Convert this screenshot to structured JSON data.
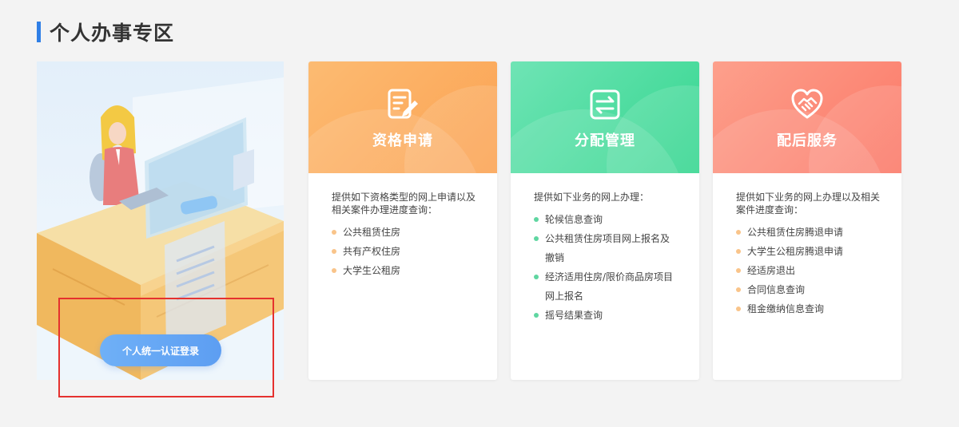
{
  "section": {
    "title": "个人办事专区"
  },
  "login": {
    "label": "个人统一认证登录"
  },
  "cards": [
    {
      "title": "资格申请",
      "icon": "edit-document-icon",
      "description": "提供如下资格类型的网上申请以及相关案件办理进度查询：",
      "items": [
        "公共租赁住房",
        "共有产权住房",
        "大学生公租房"
      ]
    },
    {
      "title": "分配管理",
      "icon": "exchange-arrows-icon",
      "description": "提供如下业务的网上办理：",
      "items": [
        "轮候信息查询",
        "公共租赁住房项目网上报名及撤销",
        "经济适用住房/限价商品房项目网上报名",
        "摇号结果查询"
      ]
    },
    {
      "title": "配后服务",
      "icon": "handshake-heart-icon",
      "description": "提供如下业务的网上办理以及相关案件进度查询：",
      "items": [
        "公共租赁住房腾退申请",
        "大学生公租房腾退申请",
        "经适房退出",
        "合同信息查询",
        "租金缴纳信息查询"
      ]
    }
  ],
  "colors": {
    "accent": "#2f7fe6",
    "orange": "#fba252",
    "green": "#34d68f",
    "red": "#fb7867",
    "highlight": "#e5312e"
  }
}
